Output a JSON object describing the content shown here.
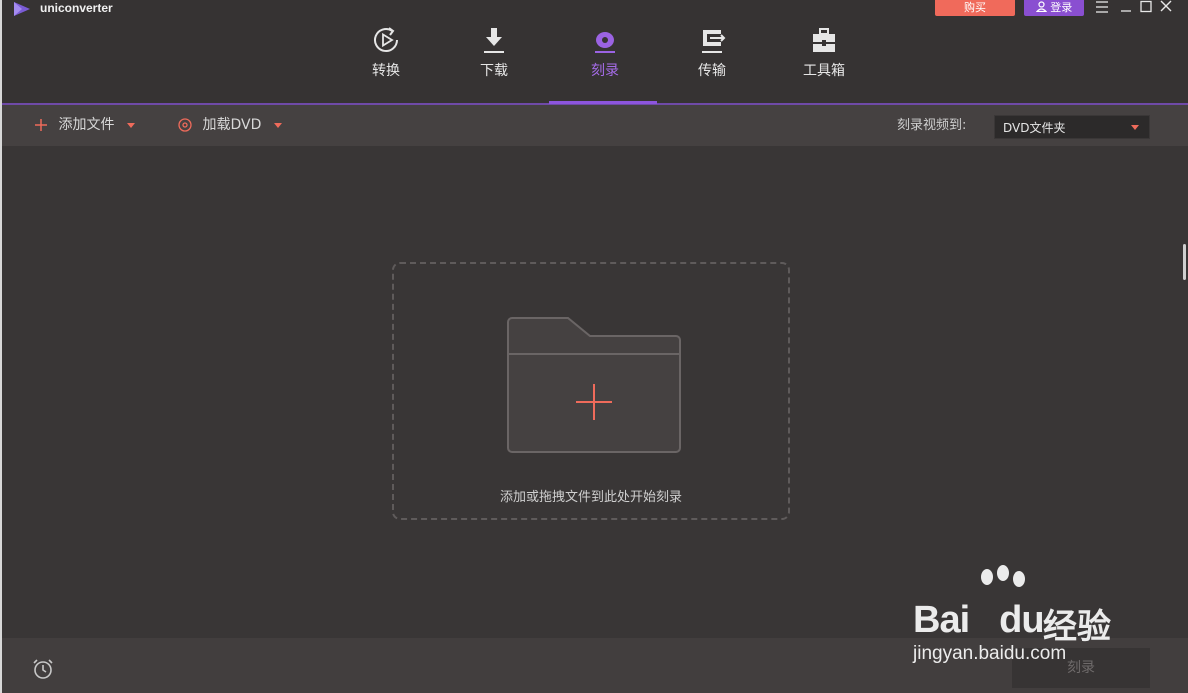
{
  "app": {
    "name": "uniconverter"
  },
  "titlebar": {
    "buy_label": "购买",
    "login_label": "登录"
  },
  "nav": {
    "items": [
      {
        "label": "转换",
        "icon": "play-circle-icon"
      },
      {
        "label": "下载",
        "icon": "download-icon"
      },
      {
        "label": "刻录",
        "icon": "disc-icon",
        "active": true
      },
      {
        "label": "传输",
        "icon": "transfer-icon"
      },
      {
        "label": "工具箱",
        "icon": "toolbox-icon"
      }
    ]
  },
  "toolbar": {
    "add_files_label": "添加文件",
    "load_dvd_label": "加载DVD",
    "burn_to_label": "刻录视频到:",
    "burn_target_value": "DVD文件夹"
  },
  "main": {
    "drop_hint": "添加或拖拽文件到此处开始刻录"
  },
  "bottom": {
    "burn_button_label": "刻录"
  },
  "watermark": {
    "brand": "Bai",
    "brand2": "du",
    "brand_cn": "经验",
    "url": "jingyan.baidu.com"
  },
  "colors": {
    "accent_purple": "#8d55de",
    "accent_red": "#ef6b5b",
    "buy_bg": "#f06a5b",
    "login_bg": "#8a4fd1"
  }
}
